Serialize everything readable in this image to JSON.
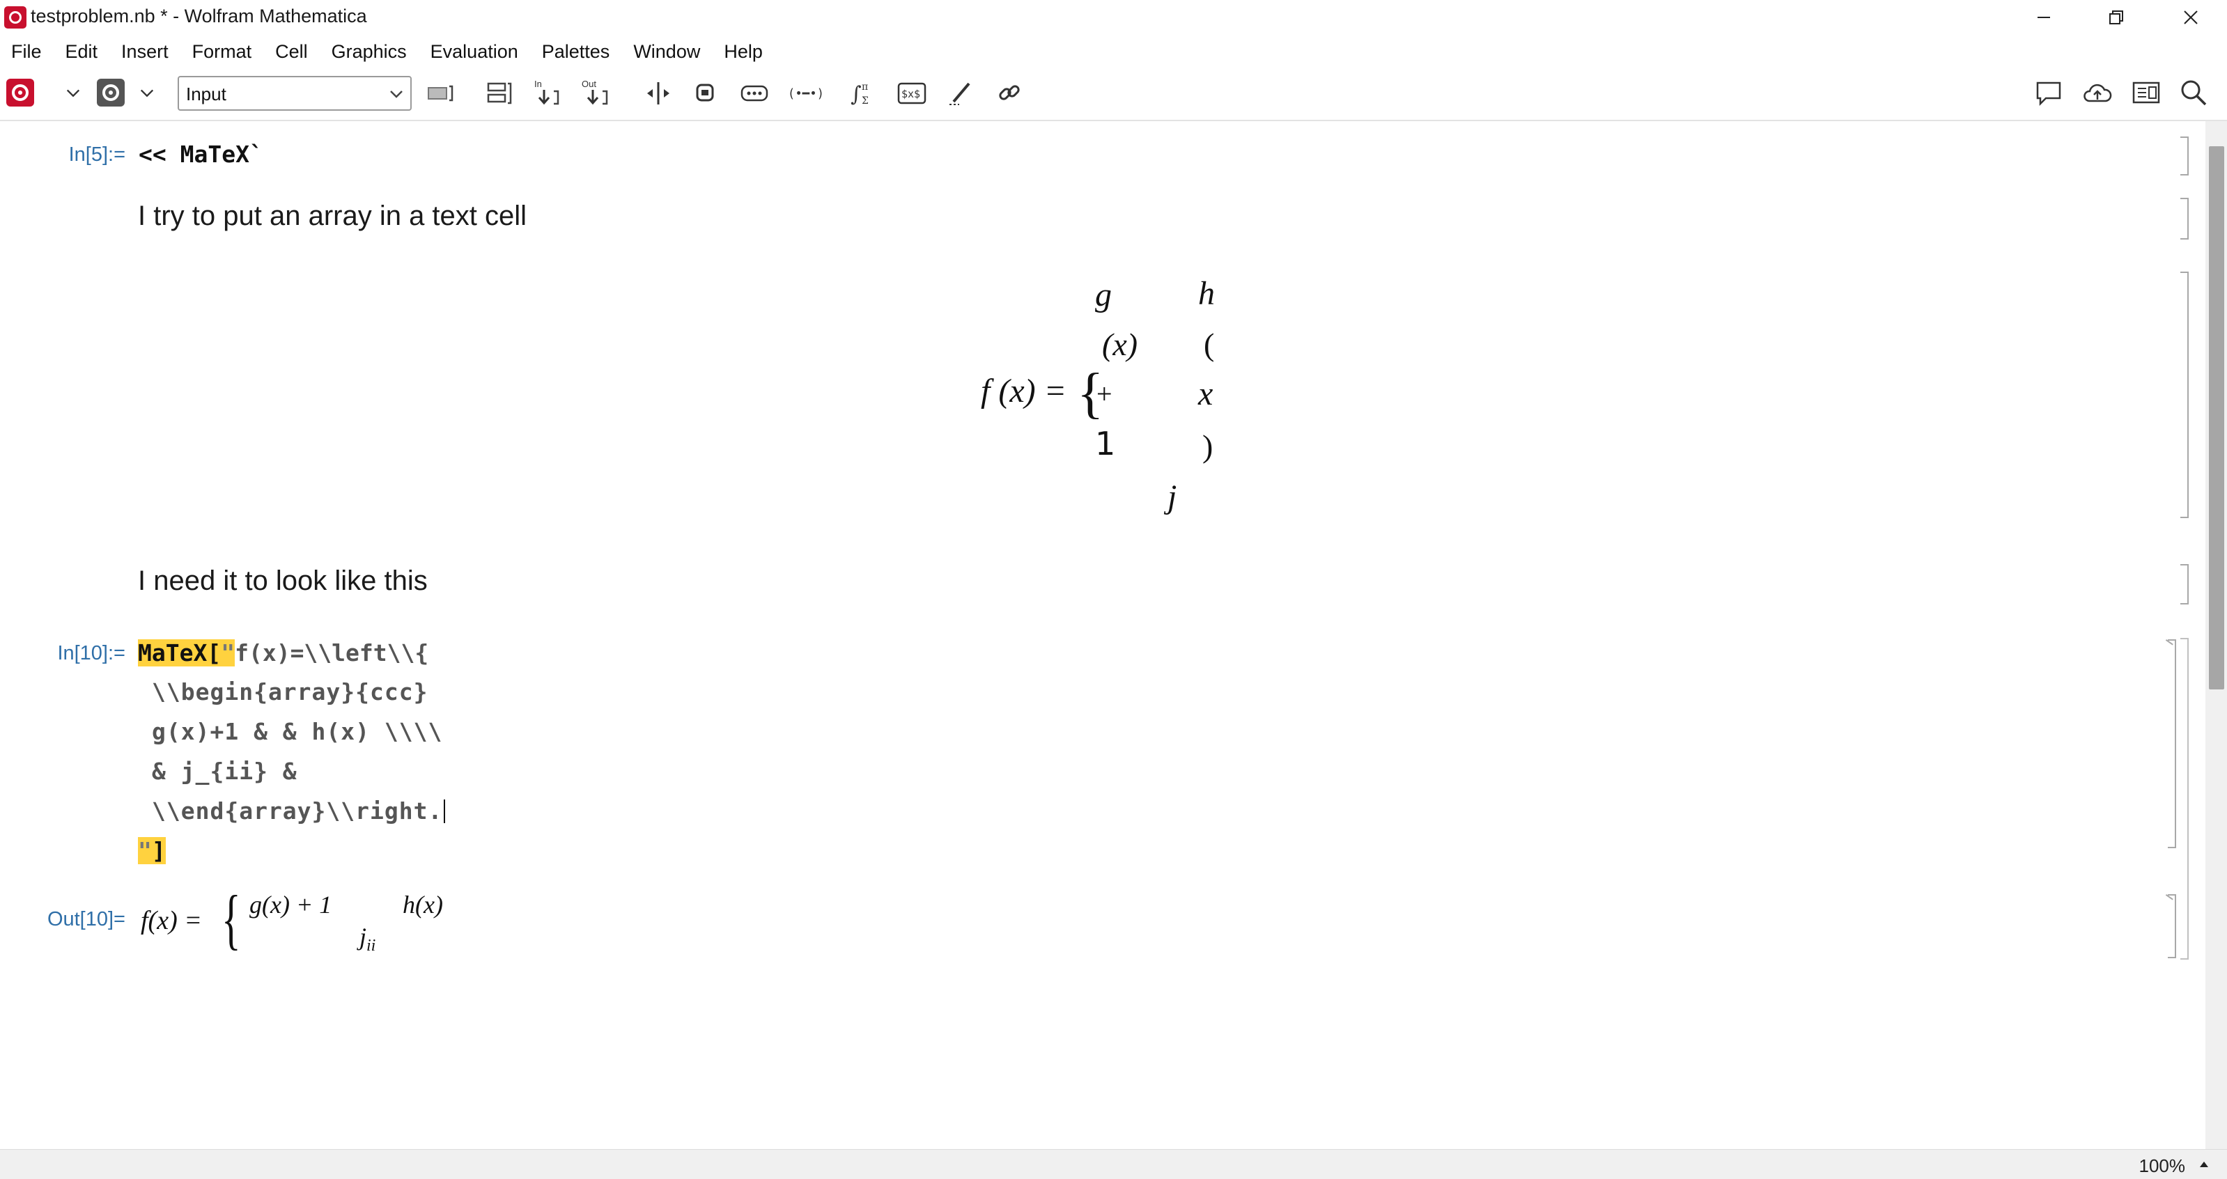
{
  "window": {
    "title": "testproblem.nb * - Wolfram Mathematica",
    "minimize_icon": "minimize-icon",
    "restore_icon": "restore-icon",
    "close_icon": "close-icon"
  },
  "menu": [
    "File",
    "Edit",
    "Insert",
    "Format",
    "Cell",
    "Graphics",
    "Evaluation",
    "Palettes",
    "Window",
    "Help"
  ],
  "toolbar": {
    "cell_style": "Input",
    "icons": [
      "evaluate-icon",
      "dropdown-icon",
      "gear-icon",
      "dropdown-icon",
      "close-group-icon",
      "split-cell-icon",
      "input-above-icon",
      "output-below-icon",
      "insert-between-icon",
      "copy-input-icon",
      "template-box-icon",
      "enclose-icon",
      "math-assistant-icon",
      "inline-tex-icon",
      "drawing-tool-icon",
      "link-icon",
      "comment-icon",
      "cloud-upload-icon",
      "notebook-view-icon",
      "search-icon"
    ],
    "accent_color": "#c8102e"
  },
  "notebook": {
    "cell1": {
      "label": "In[5]:=",
      "code": "<< MaTeX`"
    },
    "text1": "I try to put an array in a text cell",
    "broken_formula": {
      "lhs": "f (x) = ",
      "brace": "{",
      "tokens": [
        "g",
        "h",
        "(x)",
        "(",
        "+",
        "x",
        "1",
        ")",
        "j"
      ]
    },
    "text2": "I need it to look like this",
    "cell2": {
      "label": "In[10]:=",
      "func": "MaTeX",
      "open": "[",
      "quote_open": "\"",
      "lines": [
        "f(x)=\\\\left\\\\{",
        "\\\\begin{array}{ccc}",
        "g(x)+1 & & h(x) \\\\\\\\",
        "& j_{ii} &",
        "\\\\end{array}\\\\right."
      ],
      "quote_close": "\"",
      "close": "]"
    },
    "output": {
      "label": "Out[10]=",
      "lhs": "f(x) = ",
      "brace": "{",
      "row1_left": "g(x) + 1",
      "row1_right": "h(x)",
      "row2_mid": "j",
      "row2_sub": "ii"
    },
    "label_color": "#2f6fa8",
    "highlight_color": "#ffd23f"
  },
  "status": {
    "zoom": "100%"
  }
}
